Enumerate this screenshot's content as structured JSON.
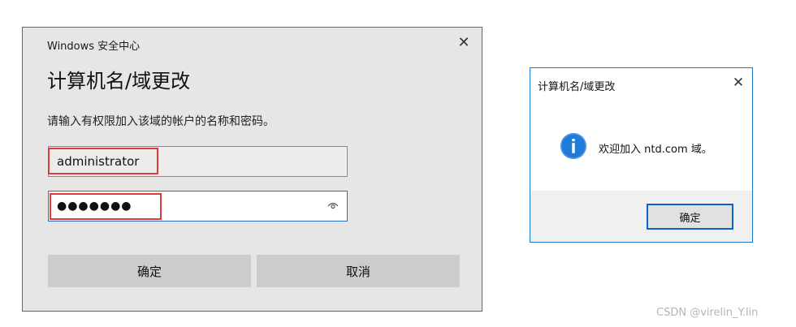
{
  "login_dialog": {
    "window_title": "Windows 安全中心",
    "heading": "计算机名/域更改",
    "prompt": "请输入有权限加入该域的帐户的名称和密码。",
    "username_value": "administrator",
    "password_value": "●●●●●●●",
    "ok_label": "确定",
    "cancel_label": "取消",
    "close_glyph": "✕",
    "password_reveal_icon": "eye-icon",
    "highlight_color": "#e23a3a"
  },
  "welcome_dialog": {
    "window_title": "计算机名/域更改",
    "message": "欢迎加入 ntd.com 域。",
    "ok_label": "确定",
    "close_glyph": "✕",
    "info_icon": "info-icon",
    "info_color": "#1f7ad8"
  },
  "watermark": "CSDN @virelin_Y.lin"
}
